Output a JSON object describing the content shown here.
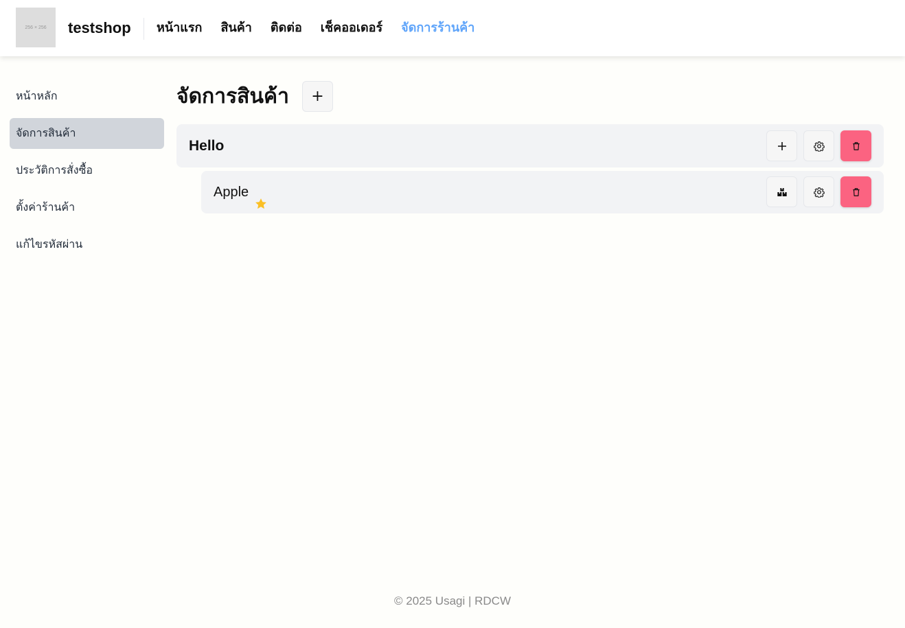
{
  "header": {
    "logo_placeholder": "256 × 256",
    "shop_name": "testshop",
    "nav": [
      {
        "label": "หน้าแรก",
        "active": false
      },
      {
        "label": "สินค้า",
        "active": false
      },
      {
        "label": "ติดต่อ",
        "active": false
      },
      {
        "label": "เช็คออเดอร์",
        "active": false
      },
      {
        "label": "จัดการร้านค้า",
        "active": true
      }
    ]
  },
  "sidebar": {
    "items": [
      {
        "label": "หน้าหลัก",
        "active": false
      },
      {
        "label": "จัดการสินค้า",
        "active": true
      },
      {
        "label": "ประวัติการสั่งซื้อ",
        "active": false
      },
      {
        "label": "ตั้งค่าร้านค้า",
        "active": false
      },
      {
        "label": "แก้ไขรหัสผ่าน",
        "active": false
      }
    ]
  },
  "main": {
    "title": "จัดการสินค้า",
    "add_label": "+",
    "category": {
      "name": "Hello",
      "add_label": "+"
    },
    "product": {
      "name": "Apple",
      "featured": true
    }
  },
  "footer": {
    "text": "© 2025 Usagi | RDCW"
  },
  "colors": {
    "accent": "#60a5fa",
    "danger": "#fb6381",
    "star": "#fbbf24",
    "sidebar_active": "#d1d5db"
  }
}
